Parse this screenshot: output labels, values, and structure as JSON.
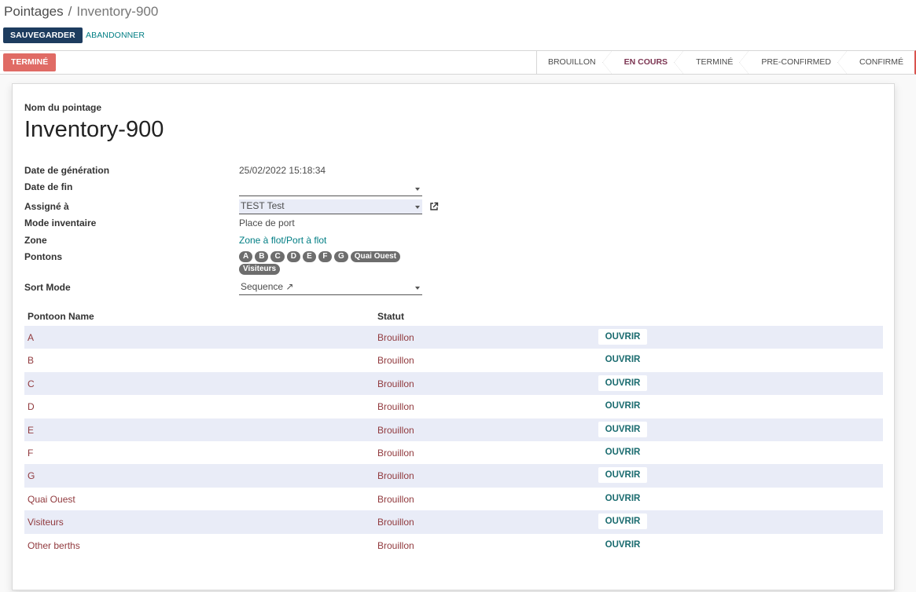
{
  "breadcrumb": {
    "parent": "Pointages",
    "separator": "/",
    "current": "Inventory-900"
  },
  "actions": {
    "save_label": "SAUVEGARDER",
    "discard_label": "ABANDONNER"
  },
  "statusbar": {
    "done_button": "TERMINÉ",
    "stages": [
      {
        "label": "BROUILLON",
        "active": false
      },
      {
        "label": "EN COURS",
        "active": true
      },
      {
        "label": "TERMINÉ",
        "active": false
      },
      {
        "label": "PRE-CONFIRMED",
        "active": false
      },
      {
        "label": "CONFIRMÉ",
        "active": false
      }
    ]
  },
  "form": {
    "name_label": "Nom du pointage",
    "name": "Inventory-900",
    "fields": {
      "generation_date": {
        "label": "Date de génération",
        "value": "25/02/2022 15:18:34"
      },
      "end_date": {
        "label": "Date de fin",
        "value": ""
      },
      "assigned": {
        "label": "Assigné à",
        "value": "TEST Test"
      },
      "mode": {
        "label": "Mode inventaire",
        "value": "Place de port"
      },
      "zone": {
        "label": "Zone",
        "value": "Zone à flot/Port à flot"
      },
      "pontoons": {
        "label": "Pontons",
        "tags": [
          "A",
          "B",
          "C",
          "D",
          "E",
          "F",
          "G",
          "Quai Ouest",
          "Visiteurs"
        ]
      },
      "sort_mode": {
        "label": "Sort Mode",
        "value": "Sequence ↗"
      }
    },
    "icons": {
      "external_link": "external-link-icon",
      "dropdown": "caret-down-icon"
    },
    "table": {
      "columns": [
        "Pontoon Name",
        "Statut"
      ],
      "button_label": "OUVRIR",
      "rows": [
        {
          "name": "A",
          "status": "Brouillon"
        },
        {
          "name": "B",
          "status": "Brouillon"
        },
        {
          "name": "C",
          "status": "Brouillon"
        },
        {
          "name": "D",
          "status": "Brouillon"
        },
        {
          "name": "E",
          "status": "Brouillon"
        },
        {
          "name": "F",
          "status": "Brouillon"
        },
        {
          "name": "G",
          "status": "Brouillon"
        },
        {
          "name": "Quai Ouest",
          "status": "Brouillon"
        },
        {
          "name": "Visiteurs",
          "status": "Brouillon"
        },
        {
          "name": "Other berths",
          "status": "Brouillon"
        }
      ]
    }
  },
  "colors": {
    "primary": "#1d3c5f",
    "link": "#017e84",
    "done": "#e06b65",
    "row_text": "#913a3e",
    "row_alt": "#e9ecf7"
  }
}
